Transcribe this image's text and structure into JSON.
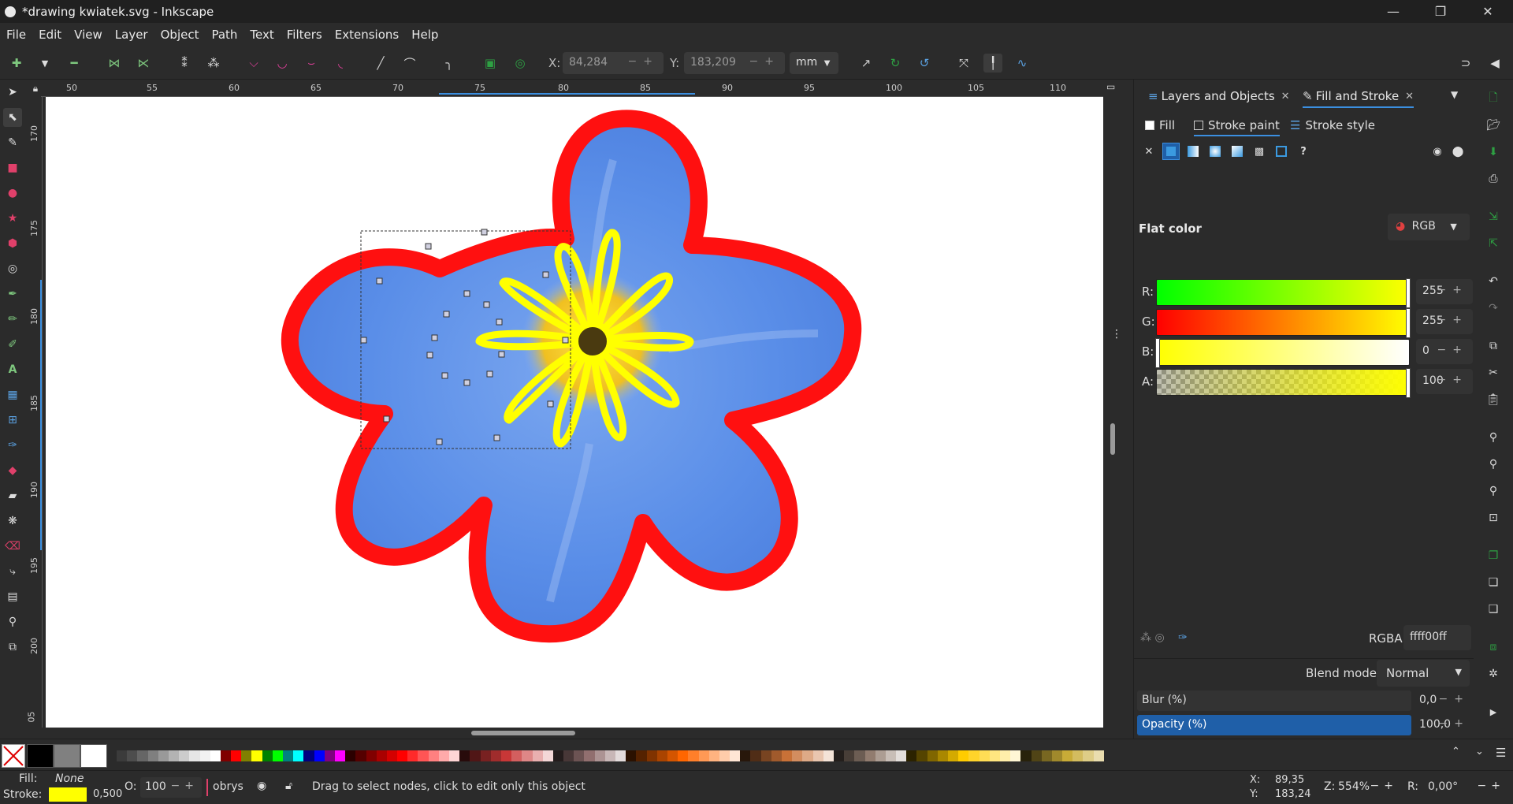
{
  "window": {
    "title": "*drawing kwiatek.svg - Inkscape",
    "minimize": "—",
    "maximize": "❐",
    "close": "✕"
  },
  "menu": [
    "File",
    "Edit",
    "View",
    "Layer",
    "Object",
    "Path",
    "Text",
    "Filters",
    "Extensions",
    "Help"
  ],
  "toolbar": {
    "x_label": "X:",
    "x_value": "84,284",
    "y_label": "Y:",
    "y_value": "183,209",
    "unit": "mm"
  },
  "ruler_top": [
    "50",
    "55",
    "60",
    "65",
    "70",
    "75",
    "80",
    "85",
    "90",
    "95",
    "100",
    "105",
    "110"
  ],
  "ruler_left": [
    "170",
    "175",
    "180",
    "185",
    "190",
    "195",
    "200",
    "05"
  ],
  "panel": {
    "tabs": [
      {
        "label": "Layers and Objects",
        "close": "✕"
      },
      {
        "label": "Fill and Stroke",
        "close": "✕"
      }
    ],
    "subtabs": [
      "Fill",
      "Stroke paint",
      "Stroke style"
    ],
    "flat_color_label": "Flat color",
    "color_mode": "RGB",
    "channels": [
      {
        "label": "R:",
        "value": "255"
      },
      {
        "label": "G:",
        "value": "255"
      },
      {
        "label": "B:",
        "value": "0"
      },
      {
        "label": "A:",
        "value": "100"
      }
    ],
    "rgba_label": "RGBA:",
    "rgba_value": "ffff00ff",
    "blend_label": "Blend mode:",
    "blend_value": "Normal",
    "blur_label": "Blur (%)",
    "blur_value": "0,0",
    "opacity_label": "Opacity (%)",
    "opacity_value": "100,0",
    "accent_color": "#1f5fa8"
  },
  "status": {
    "fill_label": "Fill:",
    "fill_value": "None",
    "stroke_label": "Stroke:",
    "stroke_width": "0,500",
    "stroke_color": "#ffff00",
    "o_label": "O:",
    "o_value": "100",
    "layer_name": "obrys",
    "message": "Drag to select nodes, click to edit only this object",
    "cursor_x_label": "X:",
    "cursor_x": "89,35",
    "cursor_y_label": "Y:",
    "cursor_y": "183,24",
    "zoom_label": "Z:",
    "zoom_value": "554%",
    "rotation_label": "R:",
    "rotation_value": "0,00°"
  },
  "palette_colors": [
    "#000000",
    "#808080",
    "#ffffff",
    "#3b3b3b",
    "#4d4d4d",
    "#666666",
    "#7f7f7f",
    "#999999",
    "#b3b3b3",
    "#cccccc",
    "#e6e6e6",
    "#f2f2f2",
    "#ffffff",
    "#800000",
    "#ff0000",
    "#808000",
    "#ffff00",
    "#008000",
    "#00ff00",
    "#008080",
    "#00ffff",
    "#000080",
    "#0000ff",
    "#800080",
    "#ff00ff",
    "#2b0000",
    "#550000",
    "#800000",
    "#aa0000",
    "#d40000",
    "#ff0000",
    "#ff2a2a",
    "#ff5555",
    "#ff8080",
    "#ffaaaa",
    "#ffd5d5",
    "#280b0b",
    "#501616",
    "#782121",
    "#a02c2c",
    "#c83737",
    "#d35f5f",
    "#de8787",
    "#e9afaf",
    "#f4d7d7",
    "#241c1c",
    "#483737",
    "#6c5353",
    "#916f6f",
    "#ac9393",
    "#c8b7b7",
    "#e3dbdb",
    "#2b1100",
    "#552200",
    "#803300",
    "#aa4400",
    "#d45500",
    "#ff6600",
    "#ff7f2a",
    "#ff9955",
    "#ffb380",
    "#ffccaa",
    "#ffe6d5",
    "#28170b",
    "#502d16",
    "#784421",
    "#a05a2c",
    "#c87137",
    "#d38d5f",
    "#deaa87",
    "#e9c6af",
    "#f4e3d7",
    "#241f1c",
    "#483e37",
    "#6c5d53",
    "#917c6f",
    "#ac9d93",
    "#c8beb7",
    "#e3dedb",
    "#2b2200",
    "#554400",
    "#806600",
    "#aa8800",
    "#d4aa00",
    "#ffcc00",
    "#ffd42a",
    "#ffdd55",
    "#ffe680",
    "#ffeeaa",
    "#fff6d5",
    "#28220b",
    "#504416",
    "#786721",
    "#a0892c",
    "#c8ab37",
    "#d3bc5f",
    "#decd87",
    "#e9ddaf"
  ]
}
